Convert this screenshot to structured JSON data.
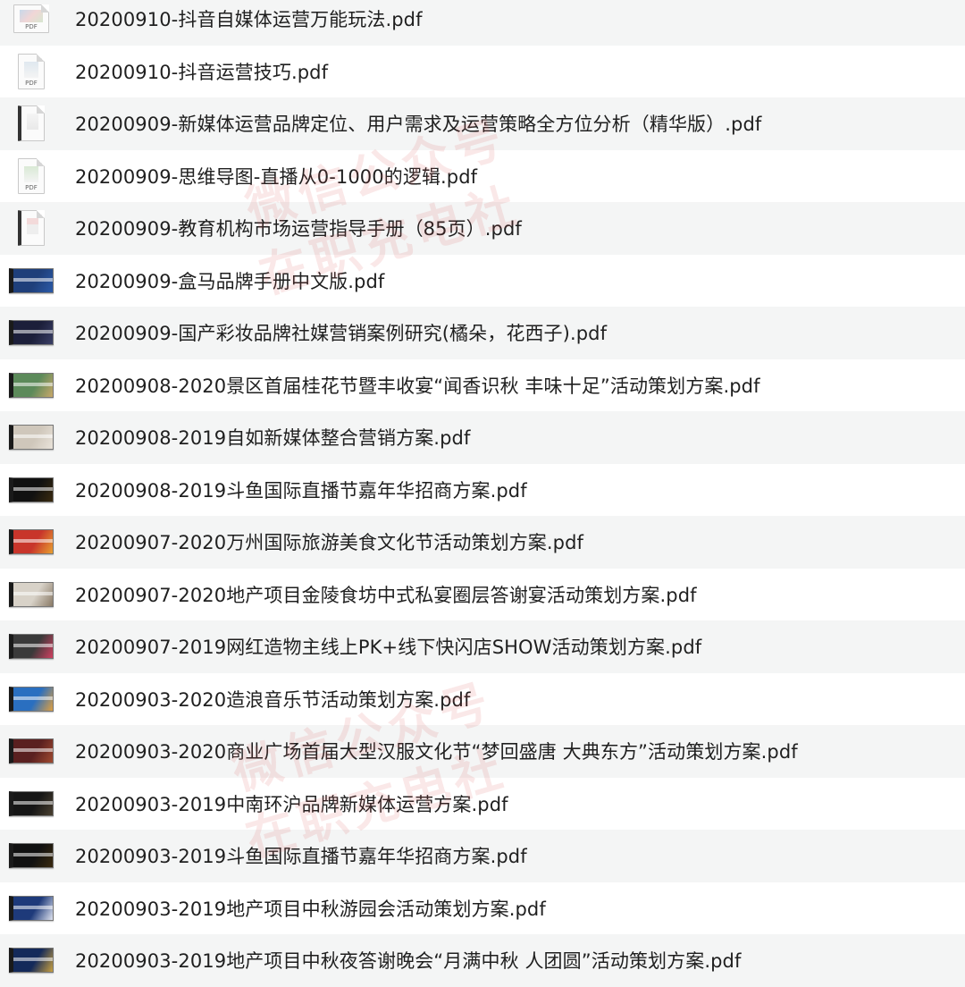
{
  "files": [
    {
      "name": "20200910-抖音自媒体运营万能玩法.pdf",
      "icon": "mind",
      "colors": [
        "#dfe8ef",
        "#f4f4f4"
      ],
      "tag": "PDF"
    },
    {
      "name": "20200910-抖音运营技巧.pdf",
      "icon": "doc",
      "colors": [
        "#dfe8ef",
        "#f4f4f4"
      ],
      "tag": "PDF"
    },
    {
      "name": "20200909-新媒体运营品牌定位、用户需求及运营策略全方位分析（精华版）.pdf",
      "icon": "bound",
      "colors": [
        "#f5f5f5",
        "#e9e9e9"
      ],
      "tag": ""
    },
    {
      "name": "20200909-思维导图-直播从0-1000的逻辑.pdf",
      "icon": "doc",
      "colors": [
        "#d9e9d5",
        "#f4f4f4"
      ],
      "tag": "PDF"
    },
    {
      "name": "20200909-教育机构市场运营指导手册（85页）.pdf",
      "icon": "bound-red",
      "colors": [
        "#f3dada",
        "#eeeeee"
      ],
      "tag": ""
    },
    {
      "name": "20200909-盒马品牌手册中文版.pdf",
      "icon": "slide",
      "colors": [
        "#1f3f7a",
        "#2b5aa8"
      ],
      "tag": ""
    },
    {
      "name": "20200909-国产彩妆品牌社媒营销案例研究(橘朵，花西子).pdf",
      "icon": "slide",
      "colors": [
        "#1c1f3a",
        "#3a3f66"
      ],
      "tag": ""
    },
    {
      "name": "20200908-2020景区首届桂花节暨丰收宴“闻香识秋 丰味十足”活动策划方案.pdf",
      "icon": "slide",
      "colors": [
        "#5c8a5a",
        "#c9a86a"
      ],
      "tag": ""
    },
    {
      "name": "20200908-2019自如新媒体整合营销方案.pdf",
      "icon": "slide",
      "colors": [
        "#cfc7bb",
        "#e9e3da"
      ],
      "tag": ""
    },
    {
      "name": "20200908-2019斗鱼国际直播节嘉年华招商方案.pdf",
      "icon": "slide",
      "colors": [
        "#111111",
        "#3a2a10"
      ],
      "tag": ""
    },
    {
      "name": "20200907-2020万州国际旅游美食文化节活动策划方案.pdf",
      "icon": "slide",
      "colors": [
        "#c8352b",
        "#e8a030"
      ],
      "tag": ""
    },
    {
      "name": "20200907-2020地产项目金陵食坊中式私宴圈层答谢宴活动策划方案.pdf",
      "icon": "slide",
      "colors": [
        "#d8d2c8",
        "#8a7a66"
      ],
      "tag": ""
    },
    {
      "name": "20200907-2019网红造物主线上PK+线下快闪店SHOW活动策划方案.pdf",
      "icon": "slide",
      "colors": [
        "#3a3a3a",
        "#d04060"
      ],
      "tag": ""
    },
    {
      "name": "20200903-2020造浪音乐节活动策划方案.pdf",
      "icon": "slide",
      "colors": [
        "#2a6fc0",
        "#e0a040"
      ],
      "tag": ""
    },
    {
      "name": "20200903-2020商业广场首届大型汉服文化节“梦回盛唐 大典东方”活动策划方案.pdf",
      "icon": "slide",
      "colors": [
        "#5a2020",
        "#a04a30"
      ],
      "tag": ""
    },
    {
      "name": "20200903-2019中南环沪品牌新媒体运营方案.pdf",
      "icon": "slide",
      "colors": [
        "#161616",
        "#4a4030"
      ],
      "tag": ""
    },
    {
      "name": "20200903-2019斗鱼国际直播节嘉年华招商方案.pdf",
      "icon": "slide",
      "colors": [
        "#111111",
        "#3a2a10"
      ],
      "tag": ""
    },
    {
      "name": "20200903-2019地产项目中秋游园会活动策划方案.pdf",
      "icon": "slide",
      "colors": [
        "#1e3a7a",
        "#e0e4f0"
      ],
      "tag": ""
    },
    {
      "name": "20200903-2019地产项目中秋夜答谢晚会“月满中秋 人团圆”活动策划方案.pdf",
      "icon": "slide",
      "colors": [
        "#142a5a",
        "#c8a040"
      ],
      "tag": ""
    }
  ],
  "watermarks": [
    "微信公众号",
    "在职充电社"
  ]
}
